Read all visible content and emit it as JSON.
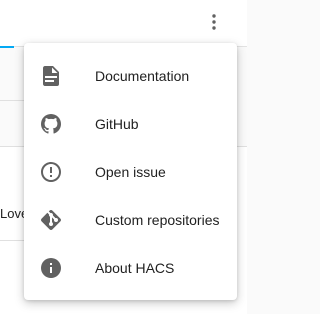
{
  "background": {
    "partial_text": "Love"
  },
  "toolbar": {
    "overflow_icon": "dots-vertical-icon"
  },
  "menu": {
    "items": [
      {
        "label": "Documentation",
        "icon": "file-document-icon"
      },
      {
        "label": "GitHub",
        "icon": "github-icon"
      },
      {
        "label": "Open issue",
        "icon": "alert-circle-outline-icon"
      },
      {
        "label": "Custom repositories",
        "icon": "git-icon"
      },
      {
        "label": "About HACS",
        "icon": "information-icon"
      }
    ]
  },
  "colors": {
    "icon": "#616161",
    "text": "#212121",
    "accent": "#03a9f4"
  }
}
